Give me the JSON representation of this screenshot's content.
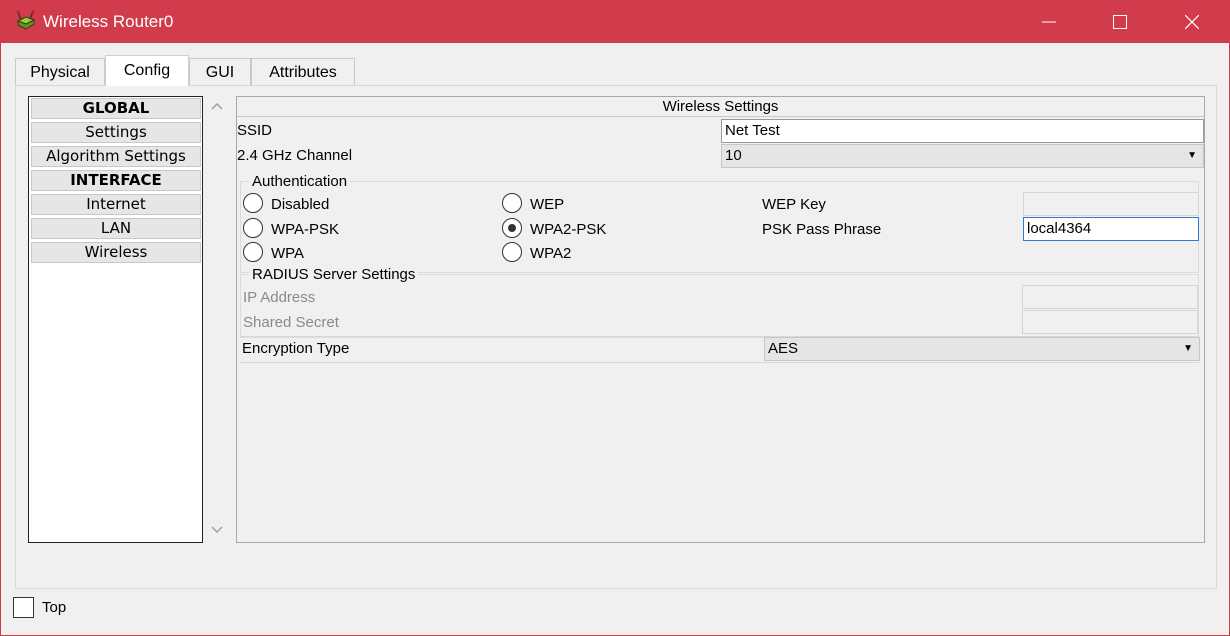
{
  "window": {
    "title": "Wireless Router0",
    "titlebar_color": "#d13b4b",
    "icon": "router-icon"
  },
  "tabs": [
    {
      "label": "Physical",
      "active": false
    },
    {
      "label": "Config",
      "active": true
    },
    {
      "label": "GUI",
      "active": false
    },
    {
      "label": "Attributes",
      "active": false
    }
  ],
  "nav": {
    "items": [
      {
        "label": "GLOBAL",
        "header": true
      },
      {
        "label": "Settings",
        "header": false
      },
      {
        "label": "Algorithm Settings",
        "header": false
      },
      {
        "label": "INTERFACE",
        "header": true
      },
      {
        "label": "Internet",
        "header": false
      },
      {
        "label": "LAN",
        "header": false
      },
      {
        "label": "Wireless",
        "header": false
      }
    ]
  },
  "wireless": {
    "header": "Wireless Settings",
    "ssid_label": "SSID",
    "ssid_value": "Net Test",
    "channel_label": "2.4 GHz Channel",
    "channel_value": "10",
    "auth": {
      "title": "Authentication",
      "options": [
        {
          "label": "Disabled",
          "selected": false
        },
        {
          "label": "WEP",
          "selected": false
        },
        {
          "label": "WPA-PSK",
          "selected": false
        },
        {
          "label": "WPA2-PSK",
          "selected": true
        },
        {
          "label": "WPA",
          "selected": false
        },
        {
          "label": "WPA2",
          "selected": false
        }
      ],
      "wep_key_label": "WEP Key",
      "wep_key_value": "",
      "psk_label": "PSK Pass Phrase",
      "psk_value": "local4364"
    },
    "radius": {
      "title": "RADIUS Server Settings",
      "ip_label": "IP Address",
      "ip_value": "",
      "secret_label": "Shared Secret",
      "secret_value": ""
    },
    "encryption_label": "Encryption Type",
    "encryption_value": "AES"
  },
  "footer": {
    "top_label": "Top",
    "top_checked": false
  }
}
